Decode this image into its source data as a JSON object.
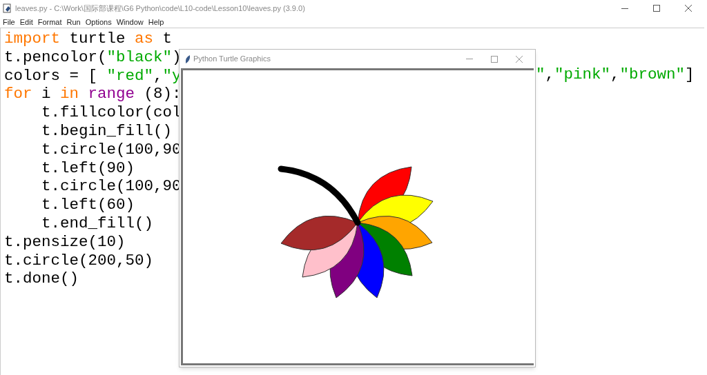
{
  "window": {
    "title": "leaves.py - C:\\Work\\国际部课程\\G6 Python\\code\\L10-code\\Lesson10\\leaves.py (3.9.0)"
  },
  "menu": [
    "File",
    "Edit",
    "Format",
    "Run",
    "Options",
    "Window",
    "Help"
  ],
  "code_lines": [
    [
      {
        "kind": "keyword",
        "text": "import"
      },
      {
        "kind": "plain",
        "text": " turtle "
      },
      {
        "kind": "keyword",
        "text": "as"
      },
      {
        "kind": "plain",
        "text": " t"
      }
    ],
    [
      {
        "kind": "plain",
        "text": "t.pencolor("
      },
      {
        "kind": "string",
        "text": "\"black\""
      },
      {
        "kind": "plain",
        "text": ")"
      }
    ],
    [
      {
        "kind": "plain",
        "text": "colors = [ "
      },
      {
        "kind": "string",
        "text": "\"red\""
      },
      {
        "kind": "plain",
        "text": ","
      },
      {
        "kind": "string",
        "text": "\"y"
      }
    ],
    [
      {
        "kind": "keyword",
        "text": "for"
      },
      {
        "kind": "plain",
        "text": " i "
      },
      {
        "kind": "keyword",
        "text": "in"
      },
      {
        "kind": "builtin",
        "text": " range"
      },
      {
        "kind": "plain",
        "text": " (8):"
      }
    ],
    [
      {
        "kind": "plain",
        "text": "    t.fillcolor(col"
      }
    ],
    [
      {
        "kind": "plain",
        "text": "    t.begin_fill()"
      }
    ],
    [
      {
        "kind": "plain",
        "text": "    t.circle(100,90"
      }
    ],
    [
      {
        "kind": "plain",
        "text": "    t.left(90)"
      }
    ],
    [
      {
        "kind": "plain",
        "text": "    t.circle(100,90"
      }
    ],
    [
      {
        "kind": "plain",
        "text": "    t.left(60)"
      }
    ],
    [
      {
        "kind": "plain",
        "text": "    t.end_fill()"
      }
    ],
    [
      {
        "kind": "plain",
        "text": "t.pensize(10)"
      }
    ],
    [
      {
        "kind": "plain",
        "text": "t.circle(200,50)"
      }
    ],
    [
      {
        "kind": "plain",
        "text": "t.done()"
      }
    ]
  ],
  "code_line_3_right": [
    {
      "kind": "string",
      "text": "\""
    },
    {
      "kind": "plain",
      "text": ","
    },
    {
      "kind": "string",
      "text": "\"pink\""
    },
    {
      "kind": "plain",
      "text": ","
    },
    {
      "kind": "string",
      "text": "\"brown\""
    },
    {
      "kind": "plain",
      "text": "]"
    }
  ],
  "turtle_window": {
    "title": "Python Turtle Graphics"
  }
}
